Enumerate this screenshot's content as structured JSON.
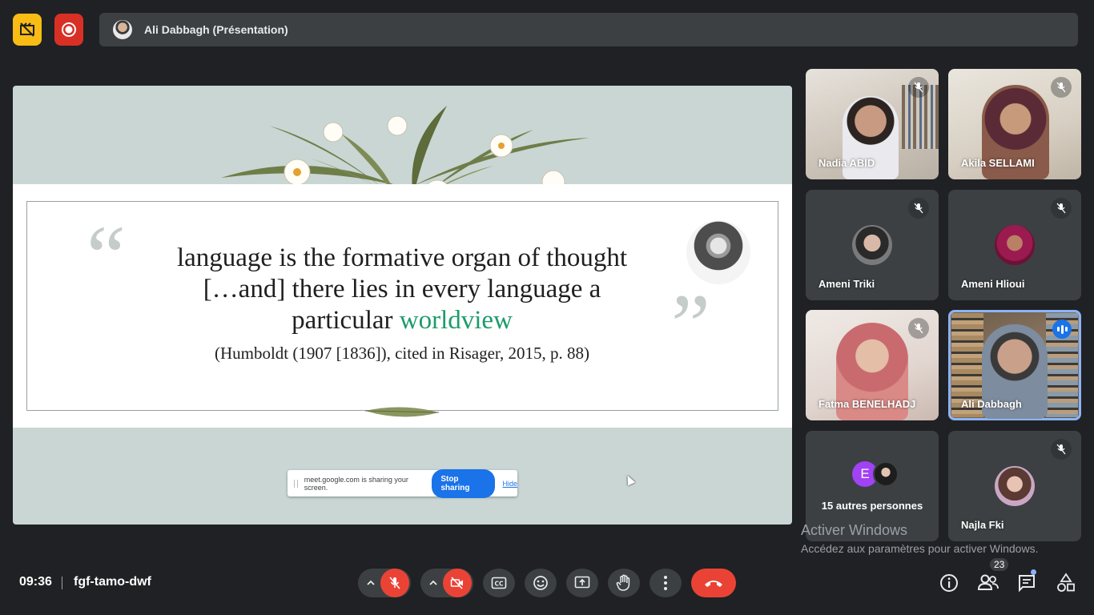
{
  "header": {
    "presenter_label": "Ali Dabbagh (Présentation)"
  },
  "slide": {
    "quote_line1": "language is the formative organ of thought",
    "quote_line2": "[…and] there lies in every language a",
    "quote_line3_pre": "particular ",
    "quote_line3_highlight": "worldview",
    "citation": "(Humboldt (1907 [1836]), cited in Risager, 2015, p. 88)",
    "highlight_color": "#1d9b6c"
  },
  "share_banner": {
    "message": "meet.google.com is sharing your screen.",
    "stop_label": "Stop sharing",
    "hide_label": "Hide"
  },
  "participants": [
    {
      "name": "Nadia ABID",
      "muted": true
    },
    {
      "name": "Akila SELLAMI",
      "muted": true
    },
    {
      "name": "Ameni Triki",
      "muted": true
    },
    {
      "name": "Ameni Hlioui",
      "muted": true
    },
    {
      "name": "Fatma BENELHADJ",
      "muted": true
    },
    {
      "name": "Ali Dabbagh",
      "muted": false,
      "speaking": true
    },
    {
      "name": "15 autres personnes",
      "initial": "E"
    },
    {
      "name": "Najla Fki",
      "muted": true
    }
  ],
  "watermark": {
    "title": "Activer Windows",
    "subtitle": "Accédez aux paramètres pour activer Windows."
  },
  "footer": {
    "time": "09:36",
    "meeting_code": "fgf-tamo-dwf",
    "participant_count": "23"
  },
  "icons": [
    "recording-disabled-icon",
    "record-icon",
    "chevron-up-icon",
    "mic-off-icon",
    "camera-off-icon",
    "captions-icon",
    "emoji-icon",
    "present-icon",
    "raise-hand-icon",
    "more-options-icon",
    "hang-up-icon",
    "info-icon",
    "people-icon",
    "chat-icon",
    "activities-icon"
  ],
  "colors": {
    "accent": "#1a73e8",
    "danger": "#ea4335",
    "record_yellow": "#f9bc15"
  }
}
